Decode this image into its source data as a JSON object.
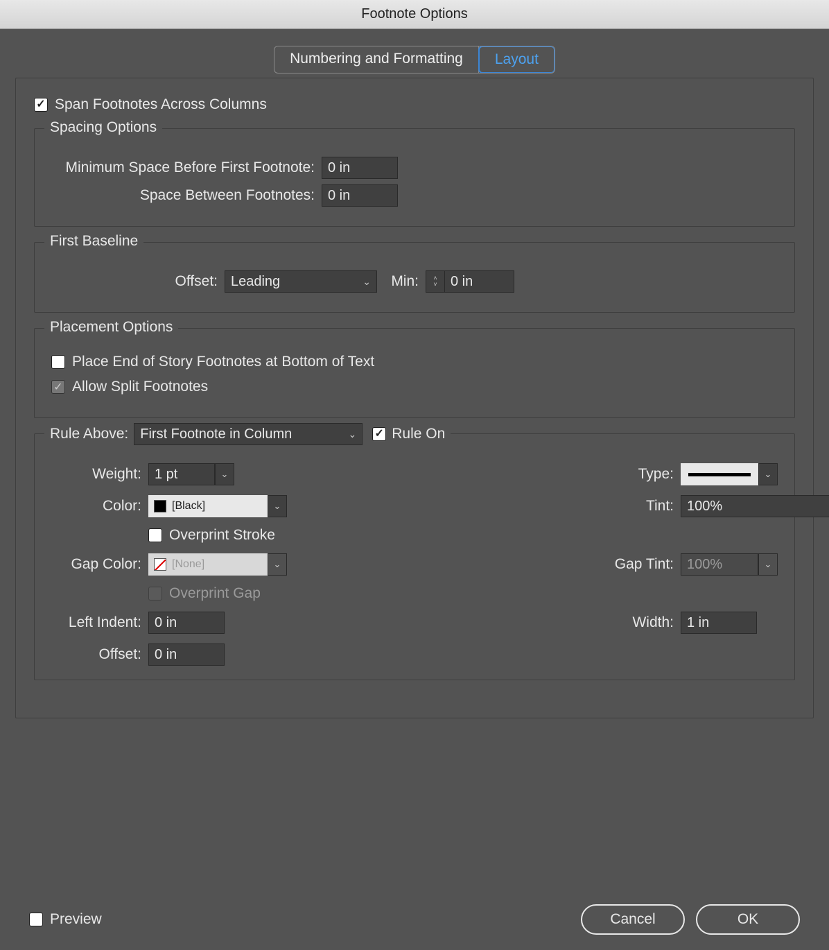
{
  "title": "Footnote Options",
  "tabs": {
    "numbering": "Numbering and Formatting",
    "layout": "Layout"
  },
  "span_columns": {
    "label": "Span Footnotes Across Columns",
    "checked": true
  },
  "spacing": {
    "title": "Spacing Options",
    "min_before_label": "Minimum Space Before First Footnote:",
    "min_before_value": "0 in",
    "between_label": "Space Between Footnotes:",
    "between_value": "0 in"
  },
  "first_baseline": {
    "title": "First Baseline",
    "offset_label": "Offset:",
    "offset_value": "Leading",
    "min_label": "Min:",
    "min_value": "0 in"
  },
  "placement": {
    "title": "Placement Options",
    "end_of_story": {
      "label": "Place End of Story Footnotes at Bottom of Text",
      "checked": false
    },
    "split": {
      "label": "Allow Split Footnotes",
      "checked": true
    }
  },
  "rule": {
    "above_label": "Rule Above:",
    "above_value": "First Footnote in Column",
    "rule_on": {
      "label": "Rule On",
      "checked": true
    },
    "weight_label": "Weight:",
    "weight_value": "1 pt",
    "type_label": "Type:",
    "color_label": "Color:",
    "color_value": "[Black]",
    "tint_label": "Tint:",
    "tint_value": "100%",
    "overprint_stroke": {
      "label": "Overprint Stroke",
      "checked": false
    },
    "gap_color_label": "Gap Color:",
    "gap_color_value": "[None]",
    "gap_tint_label": "Gap Tint:",
    "gap_tint_value": "100%",
    "overprint_gap": {
      "label": "Overprint Gap",
      "checked": false
    },
    "left_indent_label": "Left Indent:",
    "left_indent_value": "0 in",
    "width_label": "Width:",
    "width_value": "1 in",
    "offset_label": "Offset:",
    "offset_value": "0 in"
  },
  "footer": {
    "preview": "Preview",
    "cancel": "Cancel",
    "ok": "OK"
  }
}
